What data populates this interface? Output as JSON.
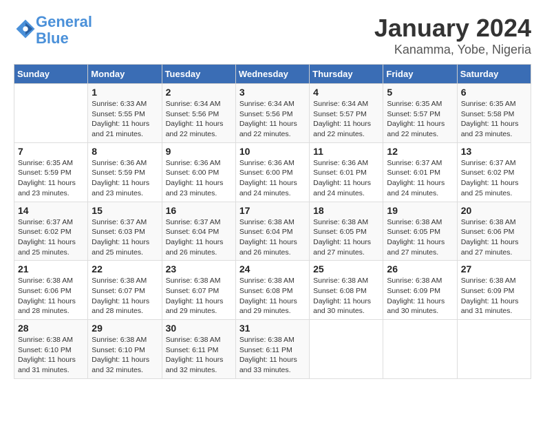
{
  "header": {
    "logo_line1": "General",
    "logo_line2": "Blue",
    "title": "January 2024",
    "subtitle": "Kanamma, Yobe, Nigeria"
  },
  "calendar": {
    "days_of_week": [
      "Sunday",
      "Monday",
      "Tuesday",
      "Wednesday",
      "Thursday",
      "Friday",
      "Saturday"
    ],
    "weeks": [
      [
        {
          "num": "",
          "info": ""
        },
        {
          "num": "1",
          "info": "Sunrise: 6:33 AM\nSunset: 5:55 PM\nDaylight: 11 hours\nand 21 minutes."
        },
        {
          "num": "2",
          "info": "Sunrise: 6:34 AM\nSunset: 5:56 PM\nDaylight: 11 hours\nand 22 minutes."
        },
        {
          "num": "3",
          "info": "Sunrise: 6:34 AM\nSunset: 5:56 PM\nDaylight: 11 hours\nand 22 minutes."
        },
        {
          "num": "4",
          "info": "Sunrise: 6:34 AM\nSunset: 5:57 PM\nDaylight: 11 hours\nand 22 minutes."
        },
        {
          "num": "5",
          "info": "Sunrise: 6:35 AM\nSunset: 5:57 PM\nDaylight: 11 hours\nand 22 minutes."
        },
        {
          "num": "6",
          "info": "Sunrise: 6:35 AM\nSunset: 5:58 PM\nDaylight: 11 hours\nand 23 minutes."
        }
      ],
      [
        {
          "num": "7",
          "info": "Sunrise: 6:35 AM\nSunset: 5:59 PM\nDaylight: 11 hours\nand 23 minutes."
        },
        {
          "num": "8",
          "info": "Sunrise: 6:36 AM\nSunset: 5:59 PM\nDaylight: 11 hours\nand 23 minutes."
        },
        {
          "num": "9",
          "info": "Sunrise: 6:36 AM\nSunset: 6:00 PM\nDaylight: 11 hours\nand 23 minutes."
        },
        {
          "num": "10",
          "info": "Sunrise: 6:36 AM\nSunset: 6:00 PM\nDaylight: 11 hours\nand 24 minutes."
        },
        {
          "num": "11",
          "info": "Sunrise: 6:36 AM\nSunset: 6:01 PM\nDaylight: 11 hours\nand 24 minutes."
        },
        {
          "num": "12",
          "info": "Sunrise: 6:37 AM\nSunset: 6:01 PM\nDaylight: 11 hours\nand 24 minutes."
        },
        {
          "num": "13",
          "info": "Sunrise: 6:37 AM\nSunset: 6:02 PM\nDaylight: 11 hours\nand 25 minutes."
        }
      ],
      [
        {
          "num": "14",
          "info": "Sunrise: 6:37 AM\nSunset: 6:02 PM\nDaylight: 11 hours\nand 25 minutes."
        },
        {
          "num": "15",
          "info": "Sunrise: 6:37 AM\nSunset: 6:03 PM\nDaylight: 11 hours\nand 25 minutes."
        },
        {
          "num": "16",
          "info": "Sunrise: 6:37 AM\nSunset: 6:04 PM\nDaylight: 11 hours\nand 26 minutes."
        },
        {
          "num": "17",
          "info": "Sunrise: 6:38 AM\nSunset: 6:04 PM\nDaylight: 11 hours\nand 26 minutes."
        },
        {
          "num": "18",
          "info": "Sunrise: 6:38 AM\nSunset: 6:05 PM\nDaylight: 11 hours\nand 27 minutes."
        },
        {
          "num": "19",
          "info": "Sunrise: 6:38 AM\nSunset: 6:05 PM\nDaylight: 11 hours\nand 27 minutes."
        },
        {
          "num": "20",
          "info": "Sunrise: 6:38 AM\nSunset: 6:06 PM\nDaylight: 11 hours\nand 27 minutes."
        }
      ],
      [
        {
          "num": "21",
          "info": "Sunrise: 6:38 AM\nSunset: 6:06 PM\nDaylight: 11 hours\nand 28 minutes."
        },
        {
          "num": "22",
          "info": "Sunrise: 6:38 AM\nSunset: 6:07 PM\nDaylight: 11 hours\nand 28 minutes."
        },
        {
          "num": "23",
          "info": "Sunrise: 6:38 AM\nSunset: 6:07 PM\nDaylight: 11 hours\nand 29 minutes."
        },
        {
          "num": "24",
          "info": "Sunrise: 6:38 AM\nSunset: 6:08 PM\nDaylight: 11 hours\nand 29 minutes."
        },
        {
          "num": "25",
          "info": "Sunrise: 6:38 AM\nSunset: 6:08 PM\nDaylight: 11 hours\nand 30 minutes."
        },
        {
          "num": "26",
          "info": "Sunrise: 6:38 AM\nSunset: 6:09 PM\nDaylight: 11 hours\nand 30 minutes."
        },
        {
          "num": "27",
          "info": "Sunrise: 6:38 AM\nSunset: 6:09 PM\nDaylight: 11 hours\nand 31 minutes."
        }
      ],
      [
        {
          "num": "28",
          "info": "Sunrise: 6:38 AM\nSunset: 6:10 PM\nDaylight: 11 hours\nand 31 minutes."
        },
        {
          "num": "29",
          "info": "Sunrise: 6:38 AM\nSunset: 6:10 PM\nDaylight: 11 hours\nand 32 minutes."
        },
        {
          "num": "30",
          "info": "Sunrise: 6:38 AM\nSunset: 6:11 PM\nDaylight: 11 hours\nand 32 minutes."
        },
        {
          "num": "31",
          "info": "Sunrise: 6:38 AM\nSunset: 6:11 PM\nDaylight: 11 hours\nand 33 minutes."
        },
        {
          "num": "",
          "info": ""
        },
        {
          "num": "",
          "info": ""
        },
        {
          "num": "",
          "info": ""
        }
      ]
    ]
  }
}
